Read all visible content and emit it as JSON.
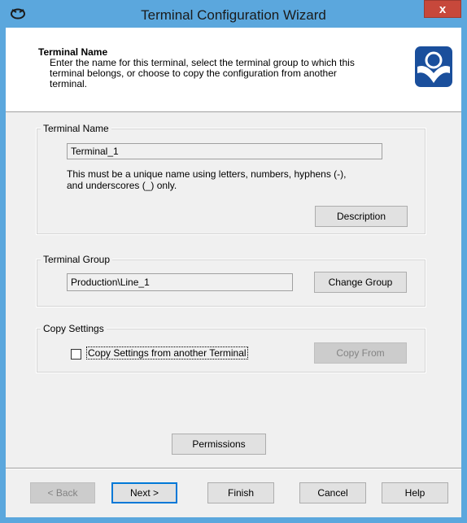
{
  "window": {
    "title": "Terminal Configuration Wizard",
    "close_label": "x"
  },
  "header": {
    "title": "Terminal Name",
    "description": "Enter the name for this terminal, select the terminal group to which this terminal belongs, or choose to copy the configuration from another terminal."
  },
  "terminal_name": {
    "legend": "Terminal Name",
    "value": "Terminal_1",
    "hint_line1": "This must be a unique name using letters, numbers, hyphens (-),",
    "hint_line2": "and underscores (_) only.",
    "description_button": "Description"
  },
  "terminal_group": {
    "legend": "Terminal Group",
    "value": "Production\\Line_1",
    "change_button": "Change Group"
  },
  "copy_settings": {
    "legend": "Copy Settings",
    "checkbox_label": "Copy Settings from another Terminal",
    "checked": false,
    "copy_from_button": "Copy From"
  },
  "permissions_button": "Permissions",
  "footer": {
    "back": "< Back",
    "next": "Next >",
    "finish": "Finish",
    "cancel": "Cancel",
    "help": "Help"
  },
  "colors": {
    "title_bar": "#5ba7dd",
    "close_button": "#c7483b",
    "logo": "#1a4f9c"
  }
}
